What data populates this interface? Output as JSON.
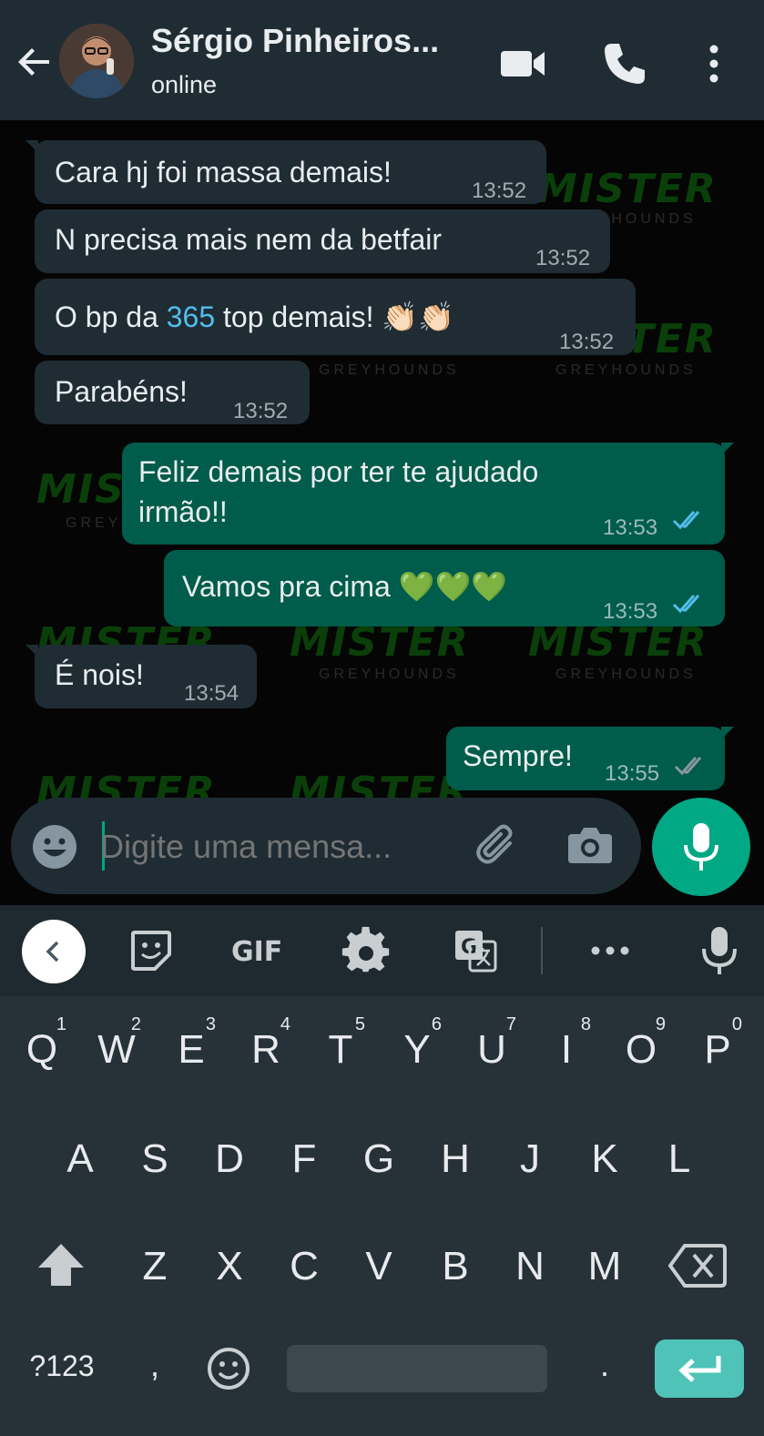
{
  "header": {
    "contact_name": "Sérgio Pinheiros...",
    "status": "online",
    "icons": [
      "back-arrow-icon",
      "video-call-icon",
      "voice-call-icon",
      "more-options-icon"
    ]
  },
  "watermark": {
    "brand": "MISTER",
    "sub": "GREYHOUNDS"
  },
  "messages": [
    {
      "dir": "in",
      "text": "Cara hj foi massa demais!",
      "time": "13:52"
    },
    {
      "dir": "in",
      "text": "N precisa mais nem da betfair",
      "time": "13:52"
    },
    {
      "dir": "in",
      "text_before": "O bp da ",
      "link": "365",
      "text_after": " top demais! 👏🏻👏🏻",
      "time": "13:52"
    },
    {
      "dir": "in",
      "text": "Parabéns!",
      "time": "13:52"
    },
    {
      "dir": "out",
      "line1": "Feliz demais por ter te ajudado",
      "line2": "irmão!!",
      "time": "13:53",
      "status": "read"
    },
    {
      "dir": "out",
      "text": "Vamos pra cima 💚💚💚",
      "time": "13:53",
      "status": "read"
    },
    {
      "dir": "in",
      "text": "É nois!",
      "time": "13:54"
    },
    {
      "dir": "out",
      "text": "Sempre!",
      "time": "13:55",
      "status": "delivered"
    }
  ],
  "input": {
    "placeholder": "Digite uma mensa..."
  },
  "keyboard": {
    "toolbar": {
      "gif_label": "GIF"
    },
    "row1": [
      {
        "k": "Q",
        "n": "1"
      },
      {
        "k": "W",
        "n": "2"
      },
      {
        "k": "E",
        "n": "3"
      },
      {
        "k": "R",
        "n": "4"
      },
      {
        "k": "T",
        "n": "5"
      },
      {
        "k": "Y",
        "n": "6"
      },
      {
        "k": "U",
        "n": "7"
      },
      {
        "k": "I",
        "n": "8"
      },
      {
        "k": "O",
        "n": "9"
      },
      {
        "k": "P",
        "n": "0"
      }
    ],
    "row2": [
      "A",
      "S",
      "D",
      "F",
      "G",
      "H",
      "J",
      "K",
      "L"
    ],
    "row3": [
      "Z",
      "X",
      "C",
      "V",
      "B",
      "N",
      "M"
    ],
    "symbols_label": "?123",
    "comma": ",",
    "period": "."
  },
  "colors": {
    "header_bg": "#1f2c34",
    "incoming_bubble": "#1f2c34",
    "outgoing_bubble": "#005c4b",
    "accent": "#00a884",
    "read_ticks": "#53bdeb",
    "keyboard_bg": "#263238"
  }
}
